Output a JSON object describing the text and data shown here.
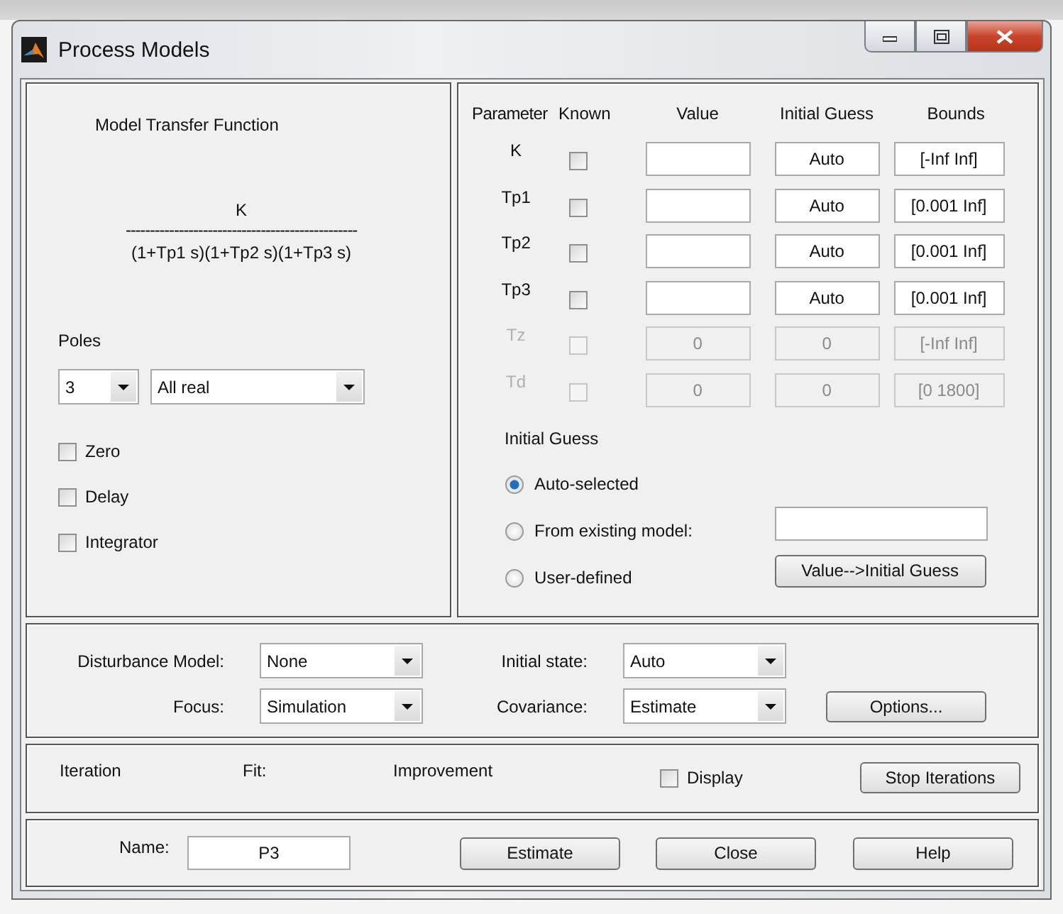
{
  "window": {
    "title": "Process Models"
  },
  "transfer_function": {
    "title": "Model Transfer Function",
    "numerator": "K",
    "divider": "------------------------------------------------",
    "denominator": "(1+Tp1 s)(1+Tp2 s)(1+Tp3 s)"
  },
  "poles": {
    "label": "Poles",
    "count": "3",
    "type": "All real"
  },
  "structure_options": [
    {
      "label": "Zero",
      "checked": false
    },
    {
      "label": "Delay",
      "checked": false
    },
    {
      "label": "Integrator",
      "checked": false
    }
  ],
  "parameters": {
    "columns": [
      "Parameter",
      "Known",
      "Value",
      "Initial Guess",
      "Bounds"
    ],
    "rows": [
      {
        "name": "K",
        "known": false,
        "disabled": false,
        "initial_guess": "Auto",
        "bounds": "[-Inf Inf]"
      },
      {
        "name": "Tp1",
        "known": false,
        "disabled": false,
        "initial_guess": "Auto",
        "bounds": "[0.001 Inf]"
      },
      {
        "name": "Tp2",
        "known": false,
        "disabled": false,
        "initial_guess": "Auto",
        "bounds": "[0.001 Inf]"
      },
      {
        "name": "Tp3",
        "known": false,
        "disabled": false,
        "initial_guess": "Auto",
        "bounds": "[0.001 Inf]"
      },
      {
        "name": "Tz",
        "known": false,
        "disabled": true,
        "value": "0",
        "initial_guess": "0",
        "bounds": "[-Inf Inf]"
      },
      {
        "name": "Td",
        "known": false,
        "disabled": true,
        "value": "0",
        "initial_guess": "0",
        "bounds": "[0 1800]"
      }
    ]
  },
  "initial_guess": {
    "title": "Initial Guess",
    "choices": [
      {
        "label": "Auto-selected",
        "selected": true
      },
      {
        "label": "From existing model:",
        "selected": false
      },
      {
        "label": "User-defined",
        "selected": false
      }
    ],
    "button": "Value-->Initial Guess"
  },
  "estimation": {
    "disturbance_model": {
      "label": "Disturbance Model:",
      "value": "None"
    },
    "focus": {
      "label": "Focus:",
      "value": "Simulation"
    },
    "initial_state": {
      "label": "Initial state:",
      "value": "Auto"
    },
    "covariance": {
      "label": "Covariance:",
      "value": "Estimate"
    },
    "options_button": "Options..."
  },
  "iteration": {
    "columns": [
      "Iteration",
      "Fit:",
      "Improvement"
    ],
    "display": {
      "label": "Display",
      "checked": false
    },
    "stop_button": "Stop Iterations"
  },
  "footer": {
    "name_label": "Name:",
    "name_value": "P3",
    "buttons": [
      "Estimate",
      "Close",
      "Help"
    ]
  }
}
